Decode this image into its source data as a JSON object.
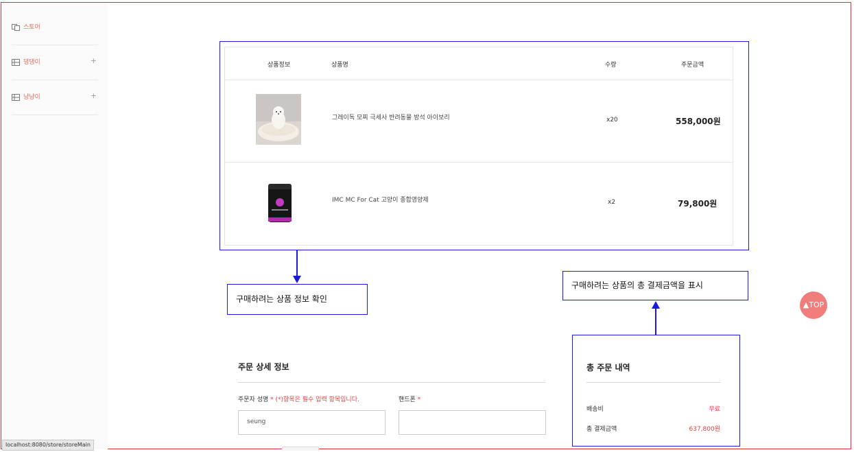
{
  "sidebar": {
    "items": [
      {
        "label": "스토어",
        "icon": "copy-icon",
        "has_plus": false
      },
      {
        "label": "댕댕이",
        "icon": "grid-icon",
        "has_plus": true
      },
      {
        "label": "냥냥이",
        "icon": "grid-icon",
        "has_plus": true
      }
    ],
    "plus": "+"
  },
  "cart": {
    "headers": {
      "info": "상품정보",
      "name": "상품명",
      "qty": "수량",
      "amount": "주문금액"
    },
    "rows": [
      {
        "name": "그레이독 모찌 극세사 반려동물 방석 아이보리",
        "qty": "x20",
        "price": "558,000원",
        "image": "dog-cushion-photo"
      },
      {
        "name": "IMC MC For Cat 고양이 종합영양제",
        "qty": "x2",
        "price": "79,800원",
        "image": "cat-supplement-photo"
      }
    ]
  },
  "annotations": {
    "product_info": "구매하려는 상품 정보 확인",
    "total_payment": "구매하려는 상품의 총 결제금액을 표시"
  },
  "top_button": "TOP",
  "order_detail": {
    "title": "주문 상세 정보",
    "orderer_label": "주문자 성명",
    "required_mark": "*",
    "required_note": "(*)항목은 필수 입력 항목입니다.",
    "phone_label": "핸드폰",
    "orderer_value": "seung",
    "phone_value": ""
  },
  "summary": {
    "title": "총 주문 내역",
    "shipping_label": "배송비",
    "shipping_value": "무료",
    "total_label": "총 결제금액",
    "total_value": "637,800원"
  },
  "status_bar": "localhost:8080/store/storeMain",
  "colors": {
    "accent": "#e26b5a",
    "annotation": "#1a1adf",
    "top_button": "#f07c7c",
    "required": "#e04040"
  }
}
